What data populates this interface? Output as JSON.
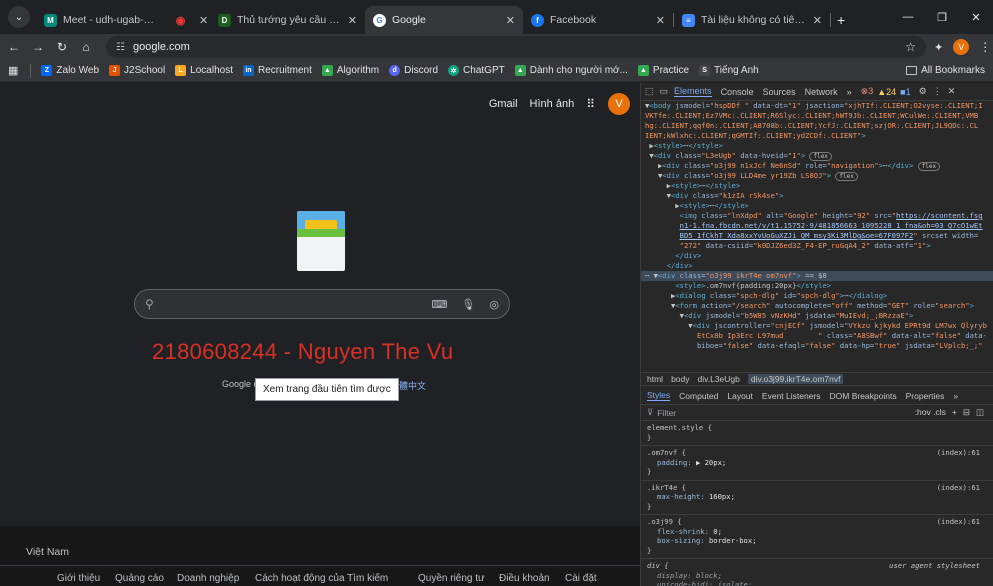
{
  "tabs": [
    {
      "title": "Meet - udh-ugab-gry",
      "color": "#00897b",
      "glyph": "M"
    },
    {
      "title": "",
      "color": "#e53935",
      "glyph": "◉"
    },
    {
      "title": "Thủ tướng yêu cầu kiểm điểm t",
      "color": "#1b5e20",
      "glyph": "D"
    },
    {
      "title": "Google",
      "color": "#4285f4",
      "glyph": "G"
    },
    {
      "title": "Facebook",
      "color": "#1877f2",
      "glyph": "f"
    },
    {
      "title": "Tài liệu không có tiêu đề - Goo",
      "color": "#4285f4",
      "glyph": "≡"
    }
  ],
  "url": "google.com",
  "profile_initial": "V",
  "bookmarks": [
    {
      "label": "Zalo Web",
      "color": "#0068ff"
    },
    {
      "label": "J2School",
      "color": "#e65100"
    },
    {
      "label": "Localhost",
      "color": "#f9a825"
    },
    {
      "label": "Recruitment",
      "color": "#0a66c2"
    },
    {
      "label": "Algorithm",
      "color": "#34a853"
    },
    {
      "label": "Discord",
      "color": "#5865f2"
    },
    {
      "label": "ChatGPT",
      "color": "#10a37f"
    },
    {
      "label": "Dành cho người mớ...",
      "color": "#34a853"
    },
    {
      "label": "Practice",
      "color": "#34a853"
    },
    {
      "label": "Tiếng Anh",
      "color": "#444444"
    }
  ],
  "all_bookmarks": "All Bookmarks",
  "google": {
    "gmail": "Gmail",
    "images": "Hình ảnh",
    "avatar": "V",
    "overlay": "2180608244 - Nguyen The Vu",
    "lang_prefix": "Google c",
    "lang_link": "繁體中文",
    "tooltip": "Xem trang đầu tiên tìm được",
    "country": "Việt Nam",
    "footer_links": [
      "Giới thiệu",
      "Quảng cáo",
      "Doanh nghiệp",
      "Cách hoạt động của Tìm kiếm",
      "Quyền riêng tư",
      "Điều khoản",
      "Cài đặt"
    ]
  },
  "devtools": {
    "tabs": [
      "Elements",
      "Console",
      "Sources",
      "Network"
    ],
    "errors": "3",
    "warnings": "24",
    "info": "1",
    "breadcrumbs": [
      "html",
      "body",
      "div.L3eUgb",
      "div.o3j99.ikrT4e.om7nvf"
    ],
    "style_tabs": [
      "Styles",
      "Computed",
      "Layout",
      "Event Listeners",
      "DOM Breakpoints",
      "Properties"
    ],
    "filter": "Filter",
    "filter_tools": ":hov .cls"
  }
}
